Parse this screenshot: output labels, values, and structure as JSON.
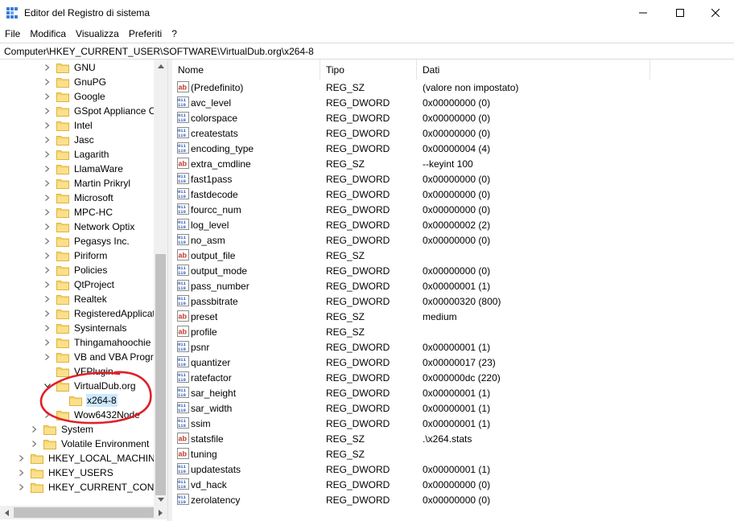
{
  "window": {
    "title": "Editor del Registro di sistema",
    "minimize_glyph": "—",
    "maximize_glyph": "☐",
    "close_glyph": "✕"
  },
  "menu": [
    "File",
    "Modifica",
    "Visualizza",
    "Preferiti",
    "?"
  ],
  "address": "Computer\\HKEY_CURRENT_USER\\SOFTWARE\\VirtualDub.org\\x264-8",
  "tree": [
    {
      "label": "GNU",
      "level": 2,
      "expandable": true
    },
    {
      "label": "GnuPG",
      "level": 2,
      "expandable": true
    },
    {
      "label": "Google",
      "level": 2,
      "expandable": true
    },
    {
      "label": "GSpot Appliance Co",
      "level": 2,
      "expandable": true
    },
    {
      "label": "Intel",
      "level": 2,
      "expandable": true
    },
    {
      "label": "Jasc",
      "level": 2,
      "expandable": true
    },
    {
      "label": "Lagarith",
      "level": 2,
      "expandable": true
    },
    {
      "label": "LlamaWare",
      "level": 2,
      "expandable": true
    },
    {
      "label": "Martin Prikryl",
      "level": 2,
      "expandable": true
    },
    {
      "label": "Microsoft",
      "level": 2,
      "expandable": true
    },
    {
      "label": "MPC-HC",
      "level": 2,
      "expandable": true
    },
    {
      "label": "Network Optix",
      "level": 2,
      "expandable": true
    },
    {
      "label": "Pegasys Inc.",
      "level": 2,
      "expandable": true
    },
    {
      "label": "Piriform",
      "level": 2,
      "expandable": true
    },
    {
      "label": "Policies",
      "level": 2,
      "expandable": true
    },
    {
      "label": "QtProject",
      "level": 2,
      "expandable": true
    },
    {
      "label": "Realtek",
      "level": 2,
      "expandable": true
    },
    {
      "label": "RegisteredApplicati",
      "level": 2,
      "expandable": true
    },
    {
      "label": "Sysinternals",
      "level": 2,
      "expandable": true
    },
    {
      "label": "Thingamahoochie",
      "level": 2,
      "expandable": true
    },
    {
      "label": "VB and VBA Progra",
      "level": 2,
      "expandable": true
    },
    {
      "label": "VFPlugin",
      "level": 2,
      "expandable": false
    },
    {
      "label": "VirtualDub.org",
      "level": 2,
      "expandable": true,
      "expanded": true
    },
    {
      "label": "x264-8",
      "level": 3,
      "expandable": false,
      "selected": true
    },
    {
      "label": "Wow6432Node",
      "level": 2,
      "expandable": true
    },
    {
      "label": "System",
      "level": 1,
      "expandable": true
    },
    {
      "label": "Volatile Environment",
      "level": 1,
      "expandable": true
    },
    {
      "label": "HKEY_LOCAL_MACHINE",
      "level": 0,
      "expandable": true
    },
    {
      "label": "HKEY_USERS",
      "level": 0,
      "expandable": true
    },
    {
      "label": "HKEY_CURRENT_CONFIG",
      "level": 0,
      "expandable": true
    }
  ],
  "columns": {
    "name": "Nome",
    "type": "Tipo",
    "data": "Dati"
  },
  "values": [
    {
      "name": "(Predefinito)",
      "type": "REG_SZ",
      "data": "(valore non impostato)",
      "icon": "string-value-icon"
    },
    {
      "name": "avc_level",
      "type": "REG_DWORD",
      "data": "0x00000000 (0)",
      "icon": "binary-value-icon"
    },
    {
      "name": "colorspace",
      "type": "REG_DWORD",
      "data": "0x00000000 (0)",
      "icon": "binary-value-icon"
    },
    {
      "name": "createstats",
      "type": "REG_DWORD",
      "data": "0x00000000 (0)",
      "icon": "binary-value-icon"
    },
    {
      "name": "encoding_type",
      "type": "REG_DWORD",
      "data": "0x00000004 (4)",
      "icon": "binary-value-icon"
    },
    {
      "name": "extra_cmdline",
      "type": "REG_SZ",
      "data": "--keyint 100",
      "icon": "string-value-icon"
    },
    {
      "name": "fast1pass",
      "type": "REG_DWORD",
      "data": "0x00000000 (0)",
      "icon": "binary-value-icon"
    },
    {
      "name": "fastdecode",
      "type": "REG_DWORD",
      "data": "0x00000000 (0)",
      "icon": "binary-value-icon"
    },
    {
      "name": "fourcc_num",
      "type": "REG_DWORD",
      "data": "0x00000000 (0)",
      "icon": "binary-value-icon"
    },
    {
      "name": "log_level",
      "type": "REG_DWORD",
      "data": "0x00000002 (2)",
      "icon": "binary-value-icon"
    },
    {
      "name": "no_asm",
      "type": "REG_DWORD",
      "data": "0x00000000 (0)",
      "icon": "binary-value-icon"
    },
    {
      "name": "output_file",
      "type": "REG_SZ",
      "data": "",
      "icon": "string-value-icon"
    },
    {
      "name": "output_mode",
      "type": "REG_DWORD",
      "data": "0x00000000 (0)",
      "icon": "binary-value-icon"
    },
    {
      "name": "pass_number",
      "type": "REG_DWORD",
      "data": "0x00000001 (1)",
      "icon": "binary-value-icon"
    },
    {
      "name": "passbitrate",
      "type": "REG_DWORD",
      "data": "0x00000320 (800)",
      "icon": "binary-value-icon"
    },
    {
      "name": "preset",
      "type": "REG_SZ",
      "data": "medium",
      "icon": "string-value-icon"
    },
    {
      "name": "profile",
      "type": "REG_SZ",
      "data": "",
      "icon": "string-value-icon"
    },
    {
      "name": "psnr",
      "type": "REG_DWORD",
      "data": "0x00000001 (1)",
      "icon": "binary-value-icon"
    },
    {
      "name": "quantizer",
      "type": "REG_DWORD",
      "data": "0x00000017 (23)",
      "icon": "binary-value-icon"
    },
    {
      "name": "ratefactor",
      "type": "REG_DWORD",
      "data": "0x000000dc (220)",
      "icon": "binary-value-icon"
    },
    {
      "name": "sar_height",
      "type": "REG_DWORD",
      "data": "0x00000001 (1)",
      "icon": "binary-value-icon"
    },
    {
      "name": "sar_width",
      "type": "REG_DWORD",
      "data": "0x00000001 (1)",
      "icon": "binary-value-icon"
    },
    {
      "name": "ssim",
      "type": "REG_DWORD",
      "data": "0x00000001 (1)",
      "icon": "binary-value-icon"
    },
    {
      "name": "statsfile",
      "type": "REG_SZ",
      "data": ".\\x264.stats",
      "icon": "string-value-icon"
    },
    {
      "name": "tuning",
      "type": "REG_SZ",
      "data": "",
      "icon": "string-value-icon"
    },
    {
      "name": "updatestats",
      "type": "REG_DWORD",
      "data": "0x00000001 (1)",
      "icon": "binary-value-icon"
    },
    {
      "name": "vd_hack",
      "type": "REG_DWORD",
      "data": "0x00000000 (0)",
      "icon": "binary-value-icon"
    },
    {
      "name": "zerolatency",
      "type": "REG_DWORD",
      "data": "0x00000000 (0)",
      "icon": "binary-value-icon"
    }
  ],
  "colors": {
    "folder": "#f5d56b",
    "folder_dark": "#dcb43c",
    "selection": "#cce8ff",
    "annotation": "#e0202a",
    "string_icon": "#c0392b",
    "binary_icon": "#2b5bb8"
  }
}
